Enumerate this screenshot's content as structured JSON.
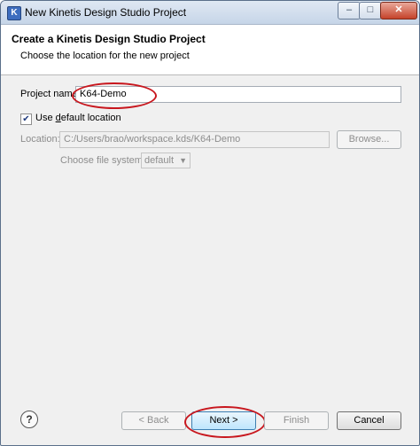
{
  "window": {
    "title": "New Kinetis Design Studio Project",
    "controls": {
      "minimize": "–",
      "maximize": "□",
      "close": "✕"
    },
    "icon": "kds-app-icon"
  },
  "header": {
    "title": "Create a Kinetis Design Studio Project",
    "subtitle": "Choose the location for the new project"
  },
  "form": {
    "project_name_label": "Project name:",
    "project_name_value": "K64-Demo",
    "use_default_pre": "Use ",
    "use_default_u": "d",
    "use_default_post": "efault location",
    "use_default_checked": true,
    "location_label": "Location:",
    "location_value": "C:/Users/brao/workspace.kds/K64-Demo",
    "browse_label": "Browse...",
    "file_system_label": "Choose file system:",
    "file_system_value": "default"
  },
  "footer": {
    "help_icon": "help-icon",
    "back_label": "< Back",
    "next_label": "Next >",
    "finish_label": "Finish",
    "cancel_label": "Cancel"
  },
  "annotation_color": "#c8171e"
}
